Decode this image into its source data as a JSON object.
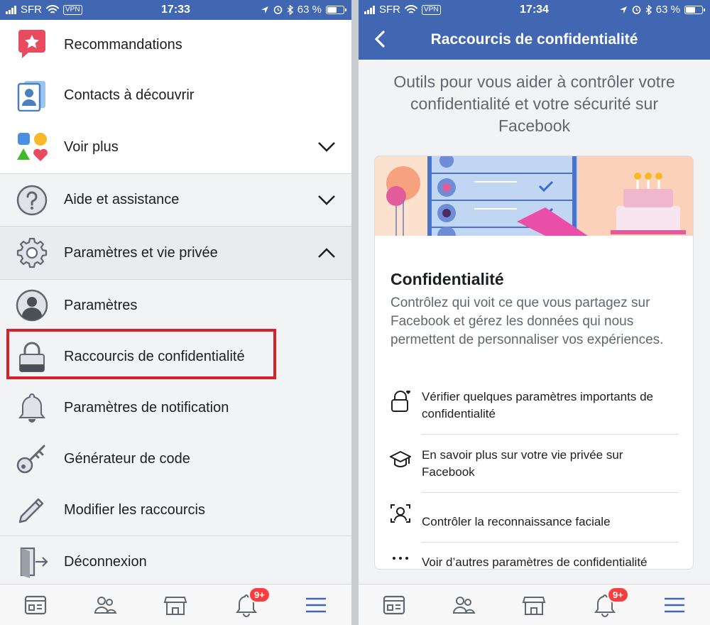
{
  "status_left": {
    "carrier": "SFR",
    "vpn": "VPN",
    "time": "17:33",
    "battery": "63 %",
    "battery_level": 0.63
  },
  "status_right": {
    "carrier": "SFR",
    "vpn": "VPN",
    "time": "17:34",
    "battery": "63 %",
    "battery_level": 0.63
  },
  "menu": {
    "recommendations": "Recommandations",
    "contacts": "Contacts à découvrir",
    "see_more": "Voir plus",
    "help": "Aide et assistance",
    "settings_privacy": "Paramètres et vie privée",
    "settings": "Paramètres",
    "privacy_shortcuts": "Raccourcis de confidentialité",
    "notification_settings": "Paramètres de notification",
    "code_generator": "Générateur de code",
    "edit_shortcuts": "Modifier les raccourcis",
    "logout": "Déconnexion"
  },
  "privacy_page": {
    "nav_title": "Raccourcis de confidentialité",
    "intro": "Outils pour vous aider à contrôler votre confidentialité et votre sécurité sur Facebook",
    "card_title": "Confidentialité",
    "card_desc": "Contrôlez qui voit ce que vous partagez sur Facebook et gérez les données qui nous permettent de personnaliser vos expériences.",
    "options": [
      "Vérifier quelques paramètres importants de confidentialité",
      "En savoir plus sur votre vie privée sur Facebook",
      "Contrôler la reconnaissance faciale",
      "Voir d’autres paramètres de confidentialité"
    ]
  },
  "tabbar": {
    "notifications_badge": "9+"
  },
  "colors": {
    "brand": "#4267b2",
    "highlight": "#d6222a",
    "badge": "#fa3e3e",
    "text_secondary": "#606770"
  },
  "icons": [
    "star-icon",
    "contacts-icon",
    "shapes-icon",
    "help-icon",
    "gear-icon",
    "avatar-icon",
    "lock-icon",
    "bell-icon",
    "key-icon",
    "pencil-icon",
    "logout-icon",
    "chevron-down-icon",
    "chevron-up-icon",
    "back-icon",
    "lock-heart-icon",
    "graduation-cap-icon",
    "face-recognition-icon",
    "more-icon",
    "news-feed-icon",
    "friends-icon",
    "marketplace-icon",
    "notifications-icon",
    "menu-icon"
  ]
}
